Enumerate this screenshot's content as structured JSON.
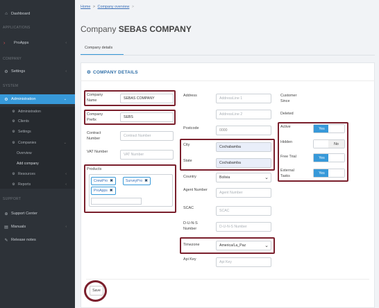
{
  "sidebar": {
    "dashboard": "Dashboard",
    "section_applications": "APPLICATIONS",
    "proapps": "ProApps",
    "section_company": "COMPANY",
    "settings": "Settings",
    "section_system": "SYSTEM",
    "administration": "Administration",
    "sub_administration": "Administration",
    "sub_clients": "Clients",
    "sub_settings": "Settings",
    "sub_companies": "Companies",
    "sub_overview": "Overview",
    "sub_add_company": "Add company",
    "sub_resources": "Resources",
    "sub_reports": "Reports",
    "section_support": "SUPPORT",
    "support_center": "Support Center",
    "manuals": "Manuals",
    "release_notes": "Release notes"
  },
  "breadcrumb": {
    "home": "Home",
    "sep": ">",
    "overview": "Company overview"
  },
  "page": {
    "title_prefix": "Company",
    "title_name": "SEBAS COMPANY"
  },
  "tab": {
    "label": "Company details"
  },
  "card": {
    "title": "COMPANY DETAILS"
  },
  "fields": {
    "company_name_label": "Company Name",
    "company_name_value": "SEBAS COMPANY",
    "company_prefix_label": "Company Prefix",
    "company_prefix_value": "SEBS",
    "contract_number_label": "Contract Number",
    "contract_number_placeholder": "Contract Number",
    "vat_number_label": "VAT Number",
    "vat_number_placeholder": "VAT Number",
    "products_label": "Products",
    "products": [
      "CrewPro",
      "SurveyPro",
      "ProApps"
    ],
    "address_label": "Address",
    "address_line1_placeholder": "AddressLine 1",
    "address_line2_placeholder": "AddressLine 2",
    "postcode_label": "Postcode",
    "postcode_value": "0000",
    "city_label": "City",
    "city_value": "Cochabamba",
    "state_label": "State",
    "state_value": "Cochabamba",
    "country_label": "Country",
    "country_value": "Bolivia",
    "agent_number_label": "Agent Number",
    "agent_number_placeholder": "Agent Number",
    "scac_label": "SCAC",
    "scac_placeholder": "SCAC",
    "duns_label": "D-U-N-S Number",
    "duns_placeholder": "D-U-N-S Number",
    "timezone_label": "Timezone",
    "timezone_value": "America/La_Paz",
    "api_key_label": "Api Key",
    "api_key_placeholder": "Api Key",
    "customer_since_label": "Customer Since",
    "deleted_label": "Deleted",
    "active_label": "Active",
    "active_value": "Yes",
    "hidden_label": "Hidden",
    "hidden_value": "No",
    "free_trial_label": "Free Trial",
    "free_trial_value": "Yes",
    "external_tasks_label": "External Tasks",
    "external_tasks_value": "Yes"
  },
  "actions": {
    "save": "Save"
  },
  "colors": {
    "accent": "#3799d9",
    "highlight": "#7a1f2c",
    "sidebar": "#2d3238"
  }
}
